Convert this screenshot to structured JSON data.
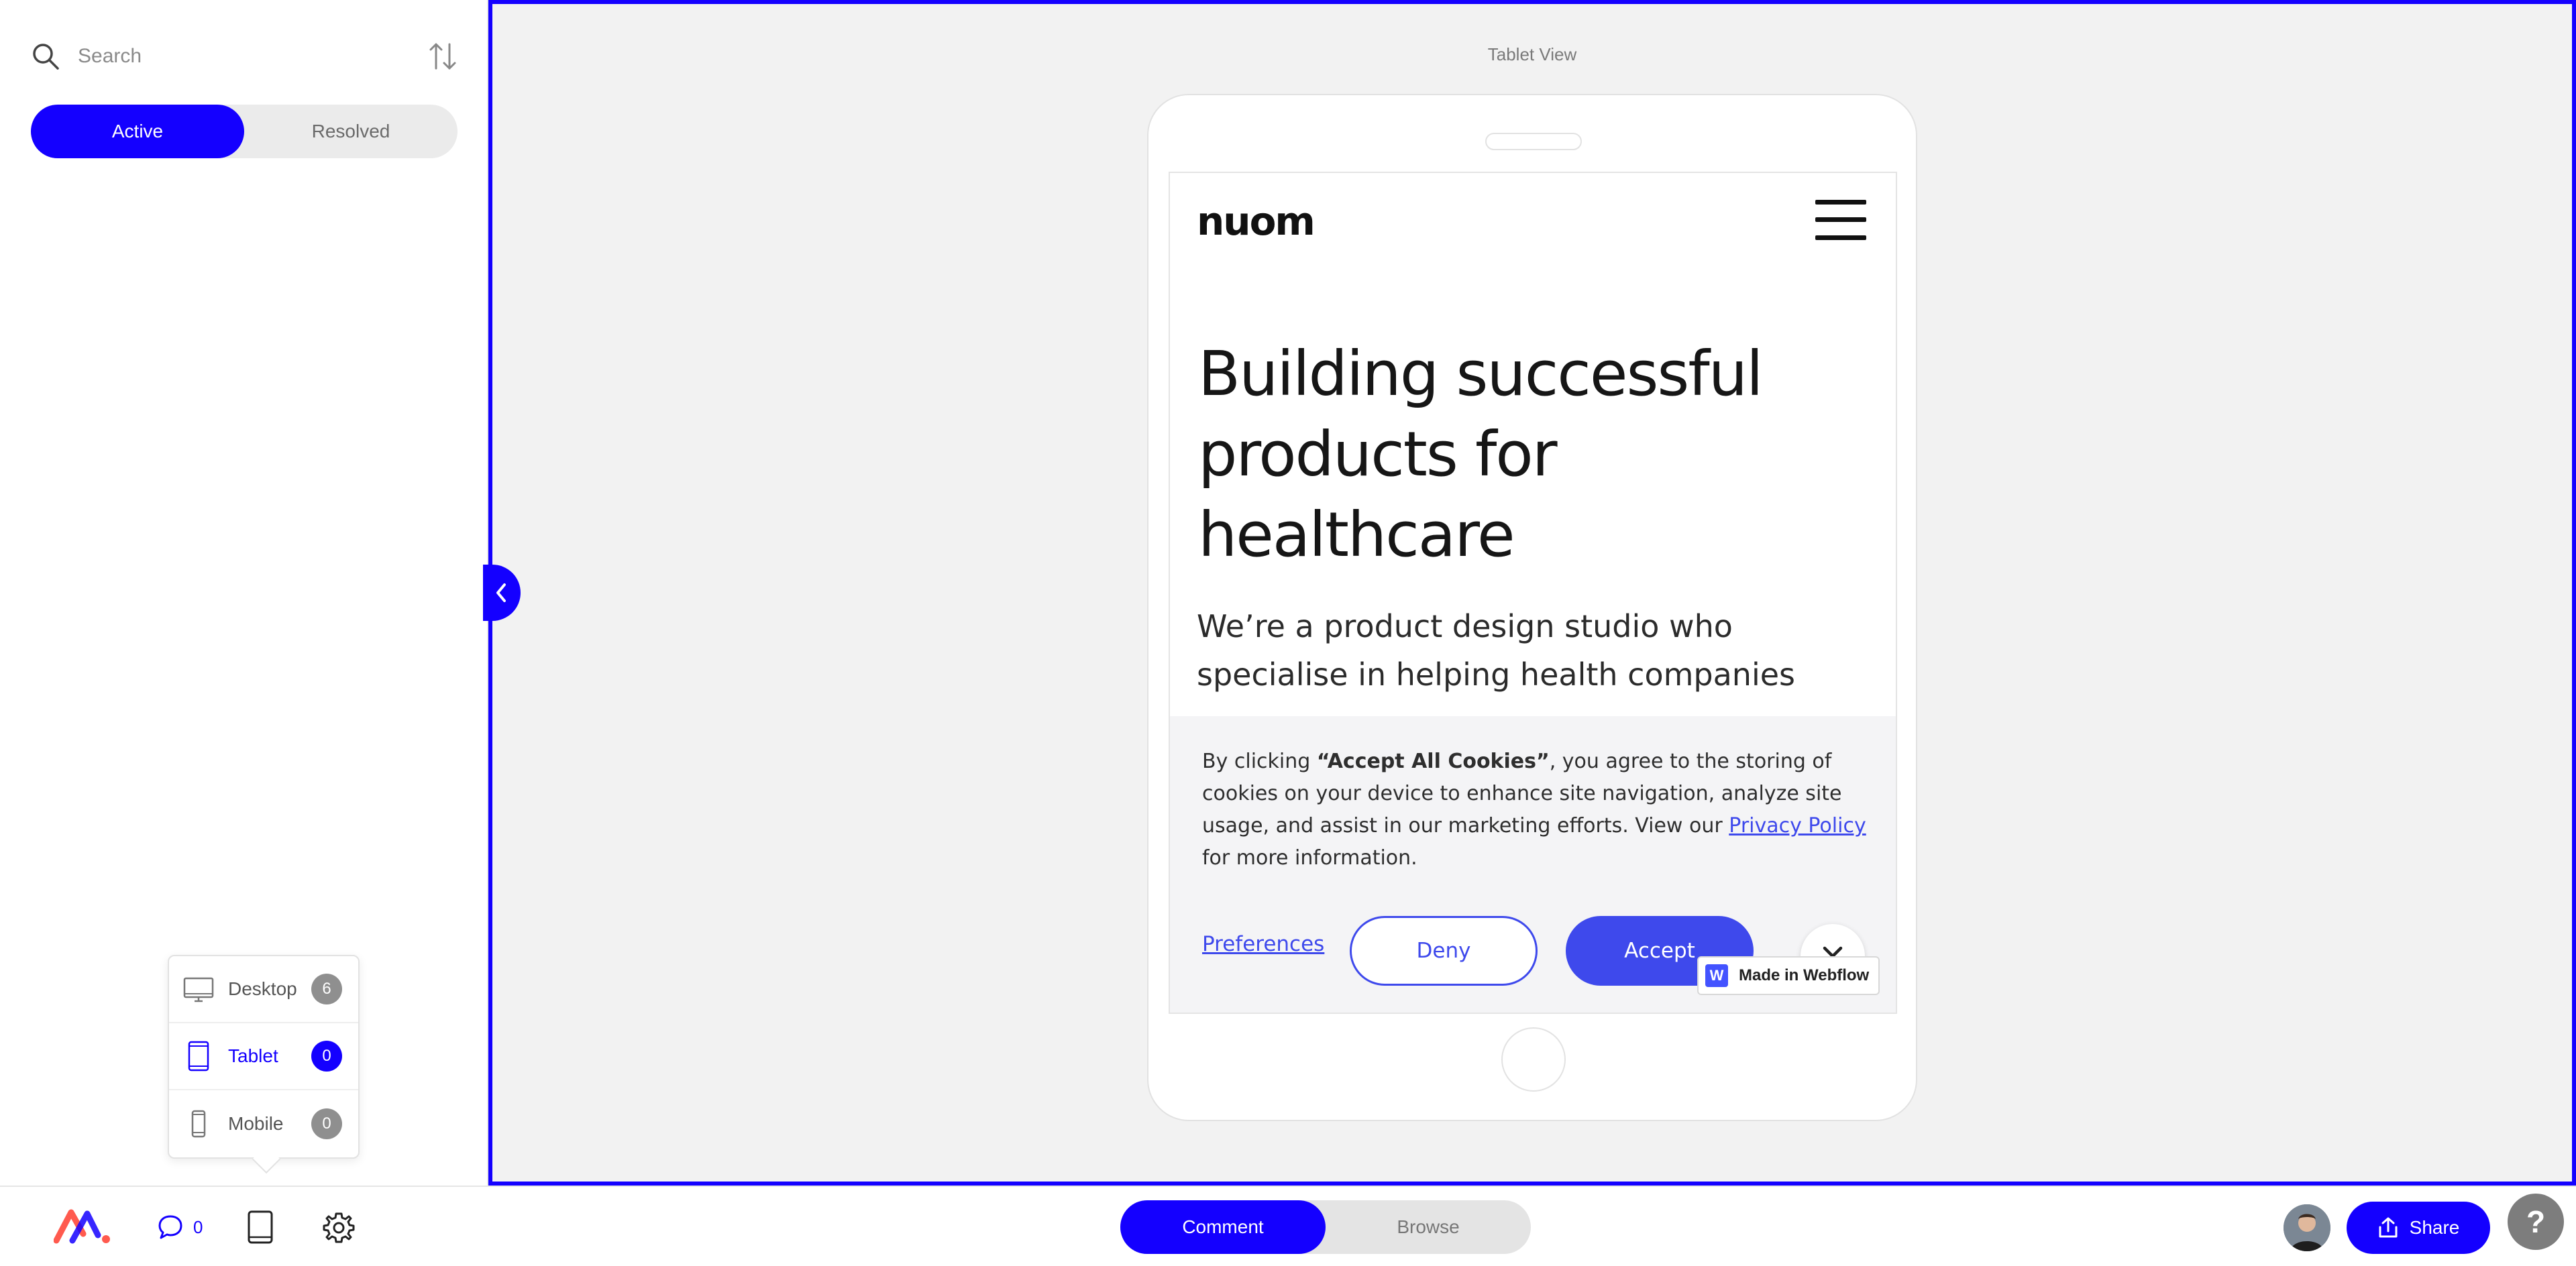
{
  "sidebar": {
    "search_placeholder": "Search",
    "status_tabs": [
      {
        "label": "Active",
        "active": true
      },
      {
        "label": "Resolved",
        "active": false
      }
    ],
    "devices": [
      {
        "label": "Desktop",
        "count": "6",
        "icon": "desktop-icon"
      },
      {
        "label": "Tablet",
        "count": "0",
        "icon": "tablet-icon",
        "selected": true
      },
      {
        "label": "Mobile",
        "count": "0",
        "icon": "mobile-icon"
      }
    ]
  },
  "canvas": {
    "view_label": "Tablet View"
  },
  "site": {
    "logo": "nuom",
    "hero_title": "Building successful products for healthcare",
    "hero_subtitle": "We’re a product design studio who specialise in helping health companies",
    "cookie": {
      "text_prefix": "By clicking ",
      "text_bold": "“Accept All Cookies”",
      "text_middle": ", you agree to the storing of cookies on your device to enhance site navigation, analyze site usage, and assist in our marketing efforts. View our ",
      "privacy_link": "Privacy Policy",
      "text_suffix": " for more information.",
      "preferences": "Preferences",
      "deny": "Deny",
      "accept": "Accept"
    },
    "webflow_badge": "Made in Webflow"
  },
  "bottombar": {
    "comment_count": "0",
    "modes": [
      {
        "label": "Comment",
        "active": true
      },
      {
        "label": "Browse",
        "active": false
      }
    ],
    "share": "Share",
    "help": "?"
  },
  "colors": {
    "accent": "#1400ff",
    "webflow_blue": "#3e49ec",
    "canvas_bg": "#f2f2f2"
  }
}
